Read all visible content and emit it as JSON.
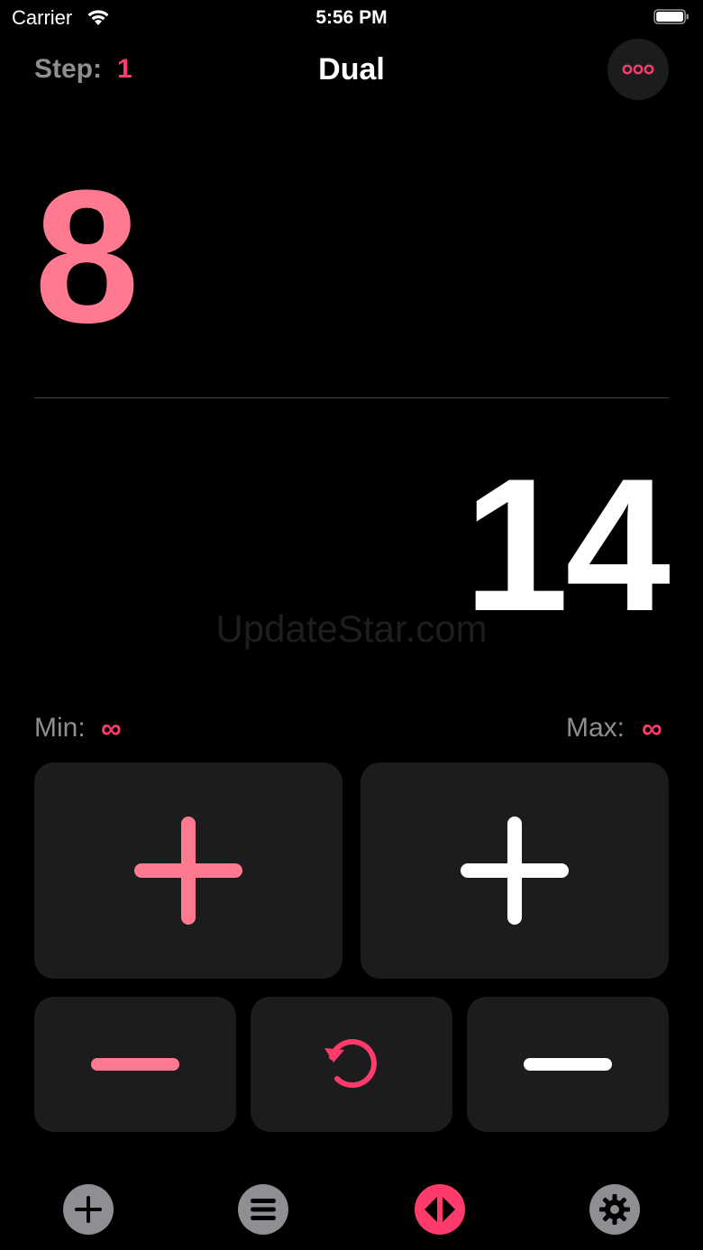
{
  "status_bar": {
    "carrier": "Carrier",
    "time": "5:56 PM",
    "wifi_icon": "wifi-icon",
    "battery_icon": "battery-icon"
  },
  "header": {
    "step_label": "Step:",
    "step_value": "1",
    "title": "Dual",
    "more_icon": "ellipsis-icon"
  },
  "counters": {
    "top_value": "8",
    "bottom_value": "14"
  },
  "watermark": "UpdateStar.com",
  "limits": {
    "min_label": "Min:",
    "min_value": "∞",
    "max_label": "Max:",
    "max_value": "∞"
  },
  "controls": {
    "plus_left_icon": "plus-icon",
    "plus_right_icon": "plus-icon",
    "minus_left_icon": "minus-icon",
    "reset_icon": "reset-icon",
    "minus_right_icon": "minus-icon"
  },
  "tab_bar": {
    "items": [
      {
        "icon": "add-circle-icon",
        "active": false
      },
      {
        "icon": "list-icon",
        "active": false
      },
      {
        "icon": "dual-icon",
        "active": true
      },
      {
        "icon": "gear-icon",
        "active": false
      }
    ]
  },
  "colors": {
    "background": "#000000",
    "accent": "#ff3b6b",
    "accent_light": "#ff7a90",
    "button_bg": "#1c1c1e",
    "secondary_text": "#8e8e93",
    "tab_inactive": "#8e8e93"
  }
}
